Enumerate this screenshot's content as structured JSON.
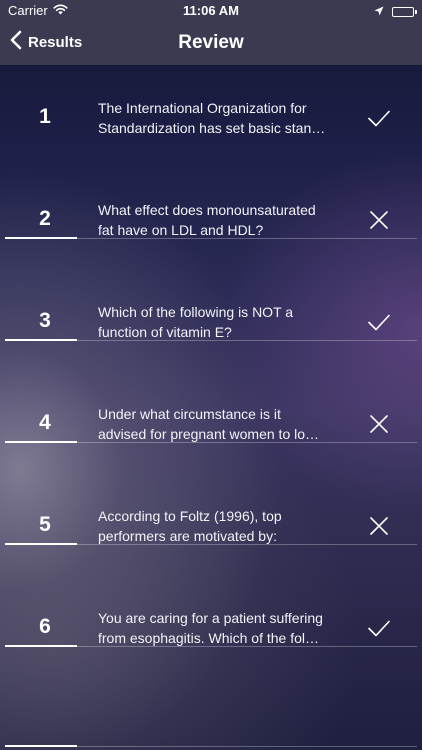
{
  "status_bar": {
    "carrier": "Carrier",
    "time": "11:06 AM"
  },
  "nav": {
    "back_label": "Results",
    "title": "Review"
  },
  "questions": [
    {
      "number": "1",
      "line1": "The International Organization for",
      "line2": "Standardization has set basic stan…",
      "result": "correct"
    },
    {
      "number": "2",
      "line1": "What effect does monounsaturated",
      "line2": "fat have on LDL and HDL?",
      "result": "incorrect"
    },
    {
      "number": "3",
      "line1": "Which of the following is NOT a",
      "line2": "function of vitamin E?",
      "result": "correct"
    },
    {
      "number": "4",
      "line1": "Under what circumstance is it",
      "line2": "advised for pregnant women to lo…",
      "result": "incorrect"
    },
    {
      "number": "5",
      "line1": "According to Foltz (1996), top",
      "line2": "performers are motivated by:",
      "result": "incorrect"
    },
    {
      "number": "6",
      "line1": "You are caring for a patient suffering",
      "line2": "from esophagitis.  Which of the fol…",
      "result": "correct"
    }
  ],
  "colors": {
    "navbar": "#3a3b50",
    "text": "#ffffff"
  }
}
